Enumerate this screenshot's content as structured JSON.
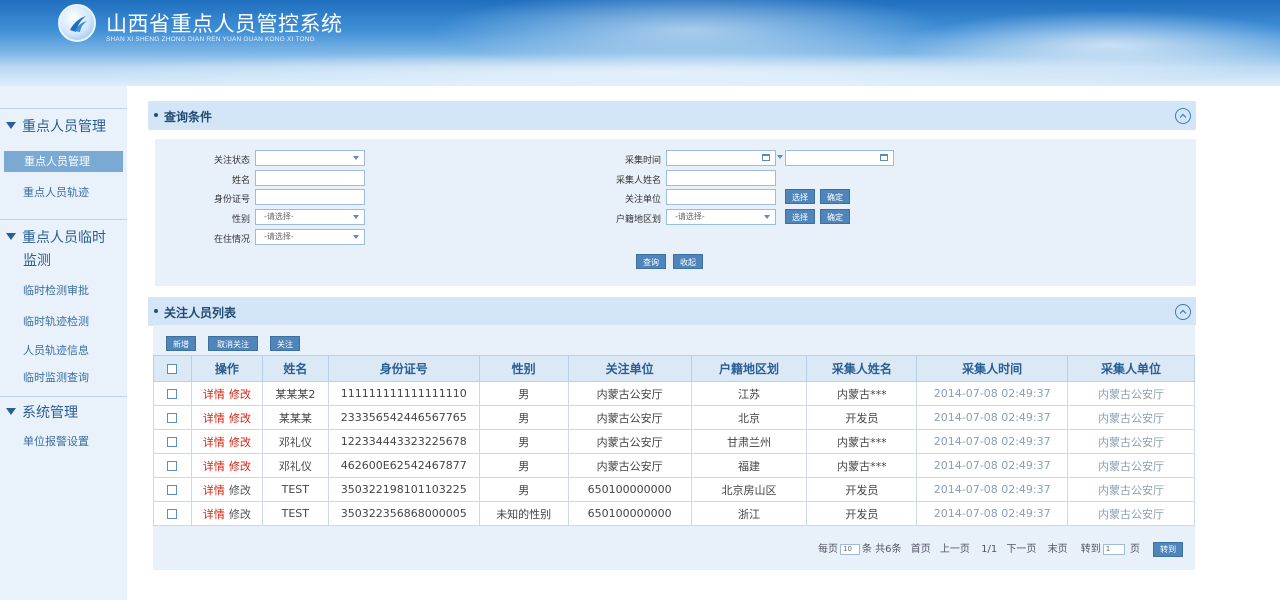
{
  "header": {
    "title": "山西省重点人员管控系统",
    "subtitle": "SHAN XI SHENG ZHONG DIAN REN YUAN GUAN KONG XI TONG",
    "logo_icon": "swoosh-logo-icon"
  },
  "sidebar": {
    "groups": [
      {
        "label": "重点人员管理",
        "items": [
          "重点人员管理",
          "重点人员轨迹"
        ]
      },
      {
        "label_line1": "重点人员临时",
        "label_line2": "监测",
        "items": [
          "临时检测审批",
          "临时轨迹检测",
          "人员轨迹信息",
          "临时监测查询"
        ]
      },
      {
        "label": "系统管理",
        "items": [
          "单位报警设置"
        ]
      }
    ],
    "active_item": "重点人员管理"
  },
  "query": {
    "title": "查询条件",
    "labels": {
      "status": "关注状态",
      "name": "姓名",
      "id": "身份证号",
      "gender": "性别",
      "residence": "在住情况",
      "collect_time": "采集时间",
      "collector_name": "采集人姓名",
      "unit": "关注单位",
      "region": "户籍地区划"
    },
    "placeholder_select": "-请选择-",
    "buttons": {
      "select": "选择",
      "confirm": "确定",
      "search": "查询",
      "collapse": "收起"
    }
  },
  "list": {
    "title": "关注人员列表",
    "toolbar": {
      "add": "新增",
      "unfollow": "取消关注",
      "follow": "关注"
    },
    "columns": [
      "操作",
      "姓名",
      "身份证号",
      "性别",
      "关注单位",
      "户籍地区划",
      "采集人姓名",
      "采集人时间",
      "采集人单位"
    ],
    "op_detail": "详情",
    "op_edit": "修改",
    "rows": [
      {
        "name": "某某某2",
        "id": "111111111111111110",
        "gender": "男",
        "unit": "内蒙古公安厅",
        "region": "江苏",
        "collector": "内蒙古***",
        "time": "2014-07-08 02:49:37",
        "cunit": "内蒙古公安厅",
        "edit_red": true
      },
      {
        "name": "某某某",
        "id": "233356542446567765",
        "gender": "男",
        "unit": "内蒙古公安厅",
        "region": "北京",
        "collector": "开发员",
        "time": "2014-07-08 02:49:37",
        "cunit": "内蒙古公安厅",
        "edit_red": true
      },
      {
        "name": "邓礼仪",
        "id": "122334443323225678",
        "gender": "男",
        "unit": "内蒙古公安厅",
        "region": "甘肃兰州",
        "collector": "内蒙古***",
        "time": "2014-07-08 02:49:37",
        "cunit": "内蒙古公安厅",
        "edit_red": true
      },
      {
        "name": "邓礼仪",
        "id": "462600E62542467877",
        "gender": "男",
        "unit": "内蒙古公安厅",
        "region": "福建",
        "collector": "内蒙古***",
        "time": "2014-07-08 02:49:37",
        "cunit": "内蒙古公安厅",
        "edit_red": true
      },
      {
        "name": "TEST",
        "id": "350322198101103225",
        "gender": "男",
        "unit": "650100000000",
        "region": "北京房山区",
        "collector": "开发员",
        "time": "2014-07-08 02:49:37",
        "cunit": "内蒙古公安厅",
        "edit_red": false
      },
      {
        "name": "TEST",
        "id": "350322356868000005",
        "gender": "未知的性别",
        "unit": "650100000000",
        "region": "浙江",
        "collector": "开发员",
        "time": "2014-07-08 02:49:37",
        "cunit": "内蒙古公安厅",
        "edit_red": false
      }
    ]
  },
  "pager": {
    "per_page_prefix": "每页",
    "per_page_value": "10",
    "per_page_suffix": "条 共6条",
    "first": "首页",
    "prev": "上一页",
    "page_info": "1/1",
    "next": "下一页",
    "last": "末页",
    "goto_prefix": "转到",
    "goto_value": "1",
    "goto_suffix": "页",
    "goto_button": "转到"
  },
  "colors": {
    "accent": "#4f85bb",
    "header_blue": "#1f6fbf",
    "link_red": "#d9230f",
    "sidebar_bg": "#e9f2fb"
  }
}
